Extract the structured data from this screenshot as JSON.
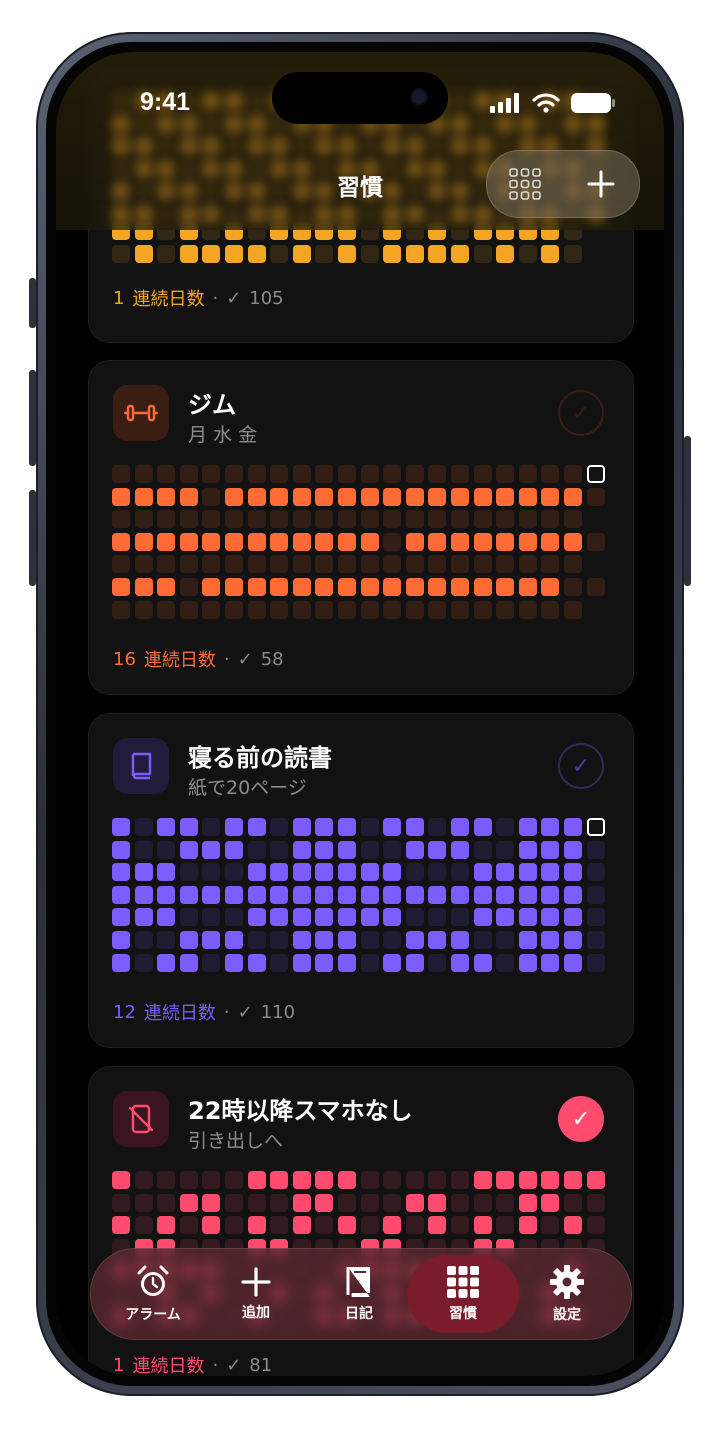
{
  "status": {
    "time": "9:41"
  },
  "header": {
    "title": "習慣",
    "grid_icon": "grid-icon",
    "add_icon": "plus-icon"
  },
  "top_card": {
    "streak": "1",
    "streak_label": "連続日数",
    "dot": "·",
    "total": "105",
    "color": "#f5a524"
  },
  "habits": [
    {
      "name": "ジム",
      "subtitle": "月 水 金",
      "icon": "dumbbell-icon",
      "color": "#ff6b35",
      "checked": false,
      "streak": "16",
      "streak_label": "連続日数",
      "dot": "·",
      "total": "58"
    },
    {
      "name": "寝る前の読書",
      "subtitle": "紙で20ページ",
      "icon": "book-icon",
      "color": "#7b5cff",
      "checked": false,
      "streak": "12",
      "streak_label": "連続日数",
      "dot": "·",
      "total": "110"
    },
    {
      "name": "22時以降スマホなし",
      "subtitle": "引き出しへ",
      "icon": "phone-off-icon",
      "color": "#ff4b6e",
      "checked": true,
      "streak": "1",
      "streak_label": "連続日数",
      "dot": "·",
      "total": "81"
    }
  ],
  "tabs": [
    {
      "label": "アラーム",
      "icon": "alarm-icon",
      "active": false
    },
    {
      "label": "追加",
      "icon": "plus-icon",
      "active": false
    },
    {
      "label": "日記",
      "icon": "book-icon",
      "active": false
    },
    {
      "label": "習慣",
      "icon": "grid-icon",
      "active": true
    },
    {
      "label": "設定",
      "icon": "gear-icon",
      "active": false
    }
  ]
}
